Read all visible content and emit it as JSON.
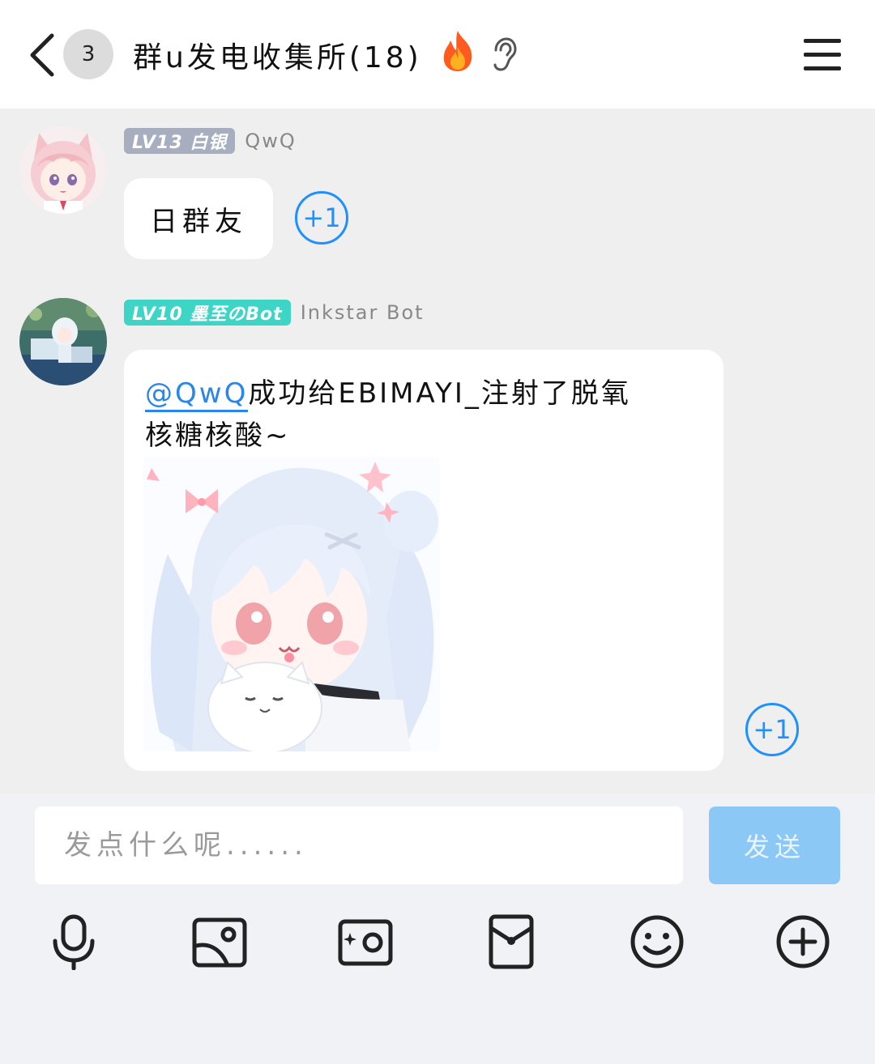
{
  "header": {
    "unread_count": "3",
    "title": "群u发电收集所(18)"
  },
  "messages": [
    {
      "level": "LV13 白银",
      "nickname": "QwQ",
      "text": "日群友",
      "plus_one": "+1"
    },
    {
      "level": "LV10 墨至のBot",
      "nickname": "Inkstar Bot",
      "mention": "@QwQ",
      "text_line1": "成功给EBIMAYI_注射了脱氧",
      "text_line2": "核糖核酸~",
      "plus_one": "+1"
    }
  ],
  "input": {
    "placeholder": "发点什么呢......",
    "send_label": "发送"
  },
  "toolbar": {
    "icons": [
      "microphone-icon",
      "image-icon",
      "camera-icon",
      "red-packet-icon",
      "emoji-icon",
      "plus-icon"
    ]
  },
  "colors": {
    "accent_blue": "#1e90ff",
    "mention_blue": "#2a86e8",
    "send_button": "#8cc8f5",
    "level_silver": "#a6aebf",
    "level_bot": "#3fd5c6"
  }
}
